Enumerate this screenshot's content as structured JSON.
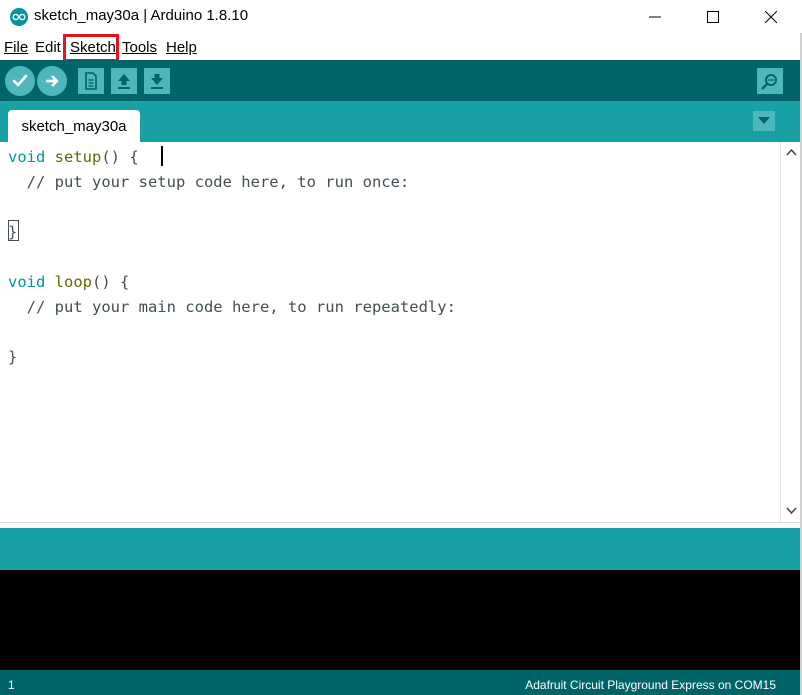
{
  "window": {
    "title": "sketch_may30a | Arduino 1.8.10",
    "app_icon": "arduino-logo-icon",
    "controls": [
      "minimize-icon",
      "maximize-icon",
      "close-icon"
    ]
  },
  "menu": {
    "file": "File",
    "edit": "Edit",
    "sketch": "Sketch",
    "tools": "Tools",
    "help": "Help",
    "highlighted": "Sketch"
  },
  "toolbar": {
    "buttons": [
      {
        "icon": "verify-check-icon"
      },
      {
        "icon": "upload-arrow-icon"
      },
      {
        "icon": "new-file-icon"
      },
      {
        "icon": "open-up-arrow-icon"
      },
      {
        "icon": "save-down-arrow-icon"
      }
    ],
    "serial_monitor_icon": "serial-monitor-magnifier-icon"
  },
  "tabs": {
    "active": "sketch_may30a",
    "menu_icon": "tab-dropdown-icon"
  },
  "editor": {
    "lines": [
      {
        "type": "void",
        "fn": "setup",
        "rest": "() {"
      },
      {
        "comment": "  // put your setup code here, to run once:"
      },
      {
        "text": ""
      },
      {
        "text": "}"
      },
      {
        "text": ""
      },
      {
        "type": "void",
        "fn": "loop",
        "rest": "() {"
      },
      {
        "comment": "  // put your main code here, to run repeatedly:"
      },
      {
        "text": ""
      },
      {
        "text": "}"
      }
    ]
  },
  "footer": {
    "line_number": "1",
    "board": "Adafruit Circuit Playground Express on COM15"
  },
  "colors": {
    "toolbar": "#006468",
    "tabbar": "#17a1a5",
    "button": "#4db7bb",
    "highlight": "#e3141e",
    "keyword_type": "#00979c",
    "keyword_fn": "#5e6d03"
  }
}
